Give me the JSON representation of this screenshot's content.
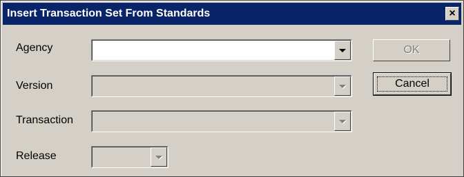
{
  "dialog": {
    "title": "Insert Transaction Set From Standards",
    "close_glyph": "×"
  },
  "fields": {
    "agency_label": "Agency",
    "agency_value": "",
    "version_label": "Version",
    "version_value": "",
    "transaction_label": "Transaction",
    "transaction_value": "",
    "release_label": "Release",
    "release_value": ""
  },
  "buttons": {
    "ok_label": "OK",
    "cancel_label": "Cancel"
  },
  "icons": {
    "close": "close-icon",
    "dropdown": "chevron-down-icon"
  },
  "colors": {
    "titlebar": "#0a246a",
    "face": "#d4d0c8"
  }
}
